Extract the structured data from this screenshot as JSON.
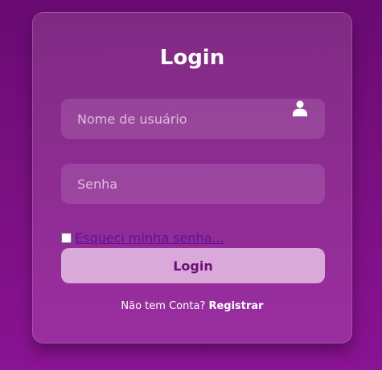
{
  "form": {
    "title": "Login",
    "username_placeholder": "Nome de usuário",
    "password_placeholder": "Senha",
    "forgot_label": "Esqueci minha senha...",
    "login_label": "Login",
    "no_account_text": "Não tem Conta?",
    "register_label": "Registrar",
    "user_icon": "user-icon"
  },
  "colors": {
    "background": "#78107f",
    "button": "#d8a9d9",
    "button_text": "#6b0f79",
    "link": "#5a1494"
  }
}
